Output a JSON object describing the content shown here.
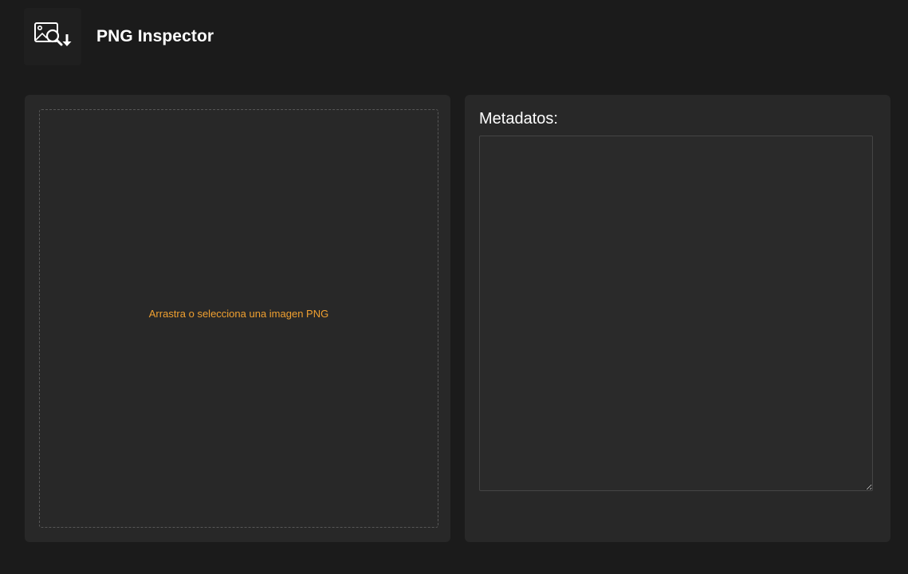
{
  "app": {
    "title": "PNG Inspector",
    "logo_icon": "image-search-download-icon"
  },
  "dropzone": {
    "prompt": "Arrastra o selecciona una imagen PNG"
  },
  "metadata": {
    "label": "Metadatos:",
    "value": ""
  },
  "colors": {
    "background": "#1b1b1b",
    "panel": "#282828",
    "accent": "#f0a030",
    "text": "#ffffff"
  }
}
